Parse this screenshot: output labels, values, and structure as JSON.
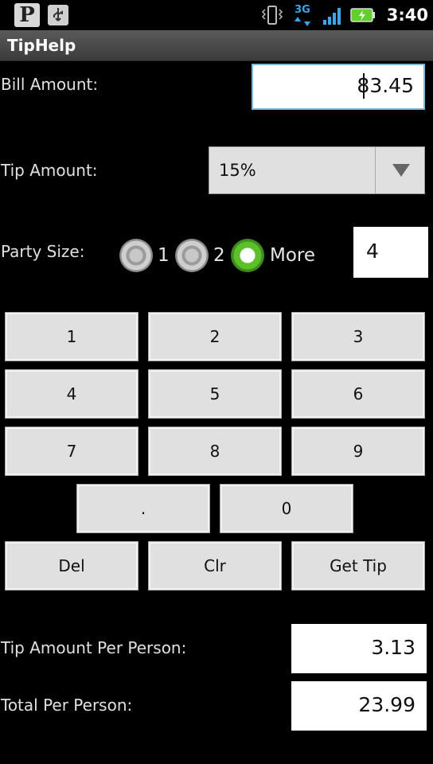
{
  "status_bar": {
    "time": "3:40",
    "icons": [
      "pandora-icon",
      "usb-icon",
      "vibrate-icon",
      "3g-icon",
      "signal-icon",
      "battery-charging-icon"
    ],
    "pandora_letter": "P",
    "network_label": "3G"
  },
  "app": {
    "title": "TipHelp"
  },
  "bill": {
    "label": "Bill Amount:",
    "value": "83.45"
  },
  "tip": {
    "label": "Tip Amount:",
    "selected": "15%"
  },
  "party": {
    "label": "Party Size:",
    "options": [
      "1",
      "2",
      "More"
    ],
    "selected": "More",
    "value": "4"
  },
  "keypad": {
    "k1": "1",
    "k2": "2",
    "k3": "3",
    "k4": "4",
    "k5": "5",
    "k6": "6",
    "k7": "7",
    "k8": "8",
    "k9": "9",
    "dot": ".",
    "k0": "0",
    "del": "Del",
    "clr": "Clr",
    "get_tip": "Get Tip"
  },
  "results": {
    "tip_per_person_label": "Tip Amount Per Person:",
    "tip_per_person_value": "3.13",
    "total_per_person_label": "Total Per Person:",
    "total_per_person_value": "23.99"
  },
  "colors": {
    "accent_green": "#5cc02a",
    "focus_border": "#7fb9d8",
    "battery_green": "#5fd12a"
  }
}
